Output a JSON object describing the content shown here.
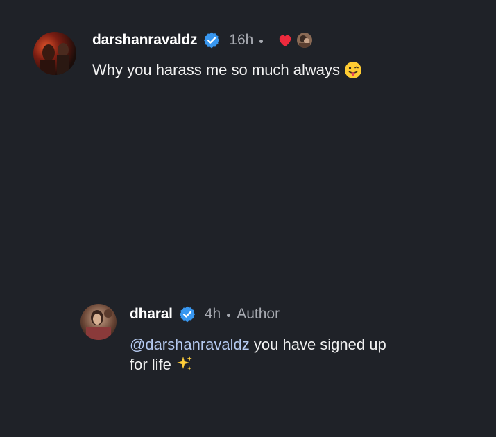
{
  "comments": [
    {
      "username": "darshanravaldz",
      "verified": true,
      "time": "16h",
      "liked_by_author": true,
      "text": "Why you harass me so much always",
      "emoji": "face-with-tongue-icon"
    }
  ],
  "reply": {
    "username": "dharal",
    "verified": true,
    "time": "4h",
    "badge": "Author",
    "mention": "@darshanravaldz",
    "text_line1": "you have signed up",
    "text_line2": "for life",
    "emoji": "sparkles-icon"
  },
  "colors": {
    "background": "#1f2228",
    "verified_blue": "#3897f0",
    "heart_red": "#ed2a3d",
    "mention": "#b5caf0",
    "meta_gray": "#a8abb2"
  }
}
